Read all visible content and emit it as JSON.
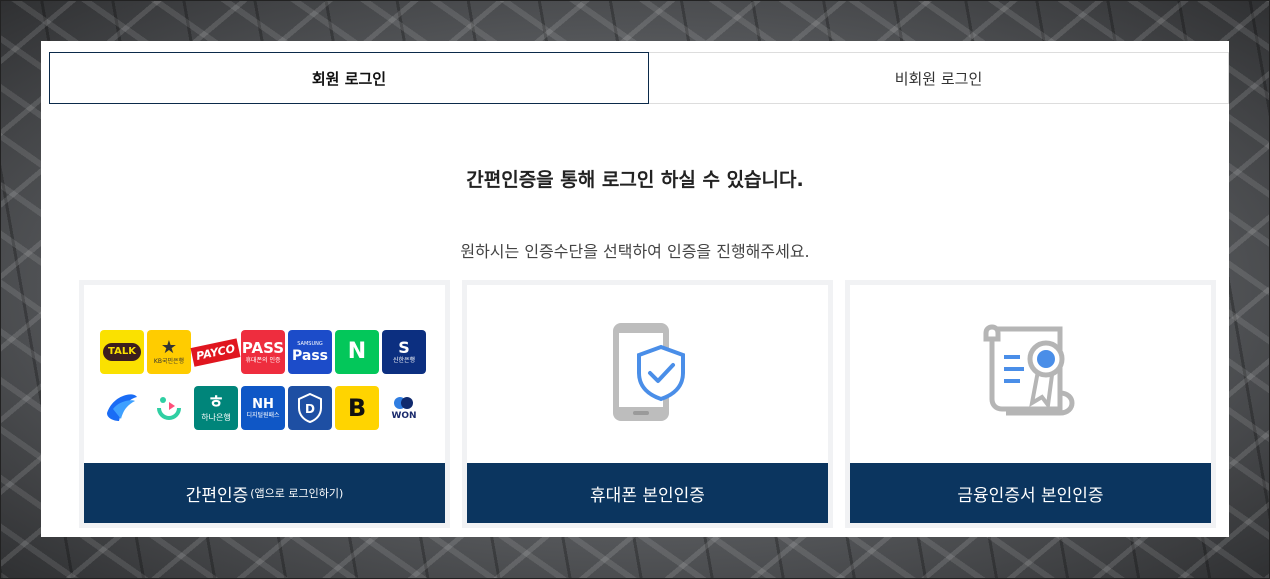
{
  "tabs": {
    "member": "회원 로그인",
    "guest": "비회원 로그인"
  },
  "headline": "간편인증을 통해 로그인 하실 수 있습니다.",
  "subline": "원하시는 인증수단을 선택하여 인증을 진행해주세요.",
  "cards": {
    "simple": {
      "label": "간편인증",
      "sublabel": "(앱으로 로그인하기)",
      "logos": {
        "talk": "TALK",
        "kb": "KB국민은행",
        "payco": "PAYCO",
        "pass": "PASS",
        "pass_sub": "휴대폰의 인증",
        "samsung_top": "SAMSUNG",
        "samsung": "Pass",
        "naver": "N",
        "shinhan": "신한은행",
        "hana": "하나은행",
        "nh": "NH",
        "nh_sub": "디지털원패스",
        "bb": "B",
        "won": "WON"
      }
    },
    "phone": {
      "label": "휴대폰 본인인증"
    },
    "cert": {
      "label": "금융인증서 본인인증"
    }
  },
  "colors": {
    "primary": "#0b355f",
    "tab_border": "#0b2a4a",
    "card_border": "#f1f2f4"
  }
}
